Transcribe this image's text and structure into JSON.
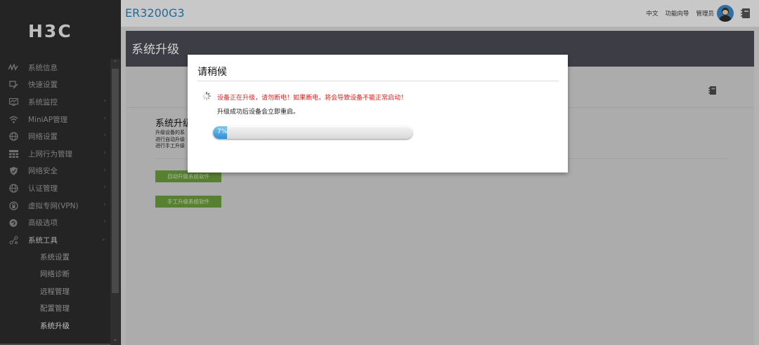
{
  "brand": {
    "logo": "H3C",
    "device_model": "ER3200G3"
  },
  "topbar": {
    "lang_link": "中文",
    "wizard_link": "功能向导",
    "admin_link": "管理员"
  },
  "sidebar": {
    "items": [
      {
        "label": "系统信息",
        "icon": "activity-icon",
        "has_children": false
      },
      {
        "label": "快速设置",
        "icon": "quick-setup-icon",
        "has_children": false
      },
      {
        "label": "系统监控",
        "icon": "monitor-icon",
        "has_children": true
      },
      {
        "label": "MiniAP管理",
        "icon": "wifi-icon",
        "has_children": true
      },
      {
        "label": "网络设置",
        "icon": "globe-icon",
        "has_children": true
      },
      {
        "label": "上网行为管理",
        "icon": "behavior-icon",
        "has_children": true
      },
      {
        "label": "网络安全",
        "icon": "shield-icon",
        "has_children": true
      },
      {
        "label": "认证管理",
        "icon": "globe-icon",
        "has_children": true
      },
      {
        "label": "虚拟专网(VPN)",
        "icon": "vpn-icon",
        "has_children": true
      },
      {
        "label": "高级选项",
        "icon": "advanced-icon",
        "has_children": true
      },
      {
        "label": "系统工具",
        "icon": "tools-icon",
        "has_children": true,
        "expanded": true
      }
    ],
    "subitems": [
      {
        "label": "系统设置",
        "active": false
      },
      {
        "label": "网络诊断",
        "active": false
      },
      {
        "label": "远程管理",
        "active": false
      },
      {
        "label": "配置管理",
        "active": false
      },
      {
        "label": "系统升级",
        "active": true
      }
    ]
  },
  "page": {
    "title": "系统升级",
    "section_title": "系统升级",
    "desc_lines": [
      "升级设备的系",
      "进行自动升级",
      "进行手工升级"
    ],
    "auto_upgrade_button": "自动升级系统软件",
    "manual_upgrade_button": "手工升级系统软件"
  },
  "dialog": {
    "title": "请稍候",
    "warning": "设备正在升级，请勿断电！如果断电，将会导致设备不能正常启动！",
    "info": "升级成功后设备会立即重启。",
    "progress_percent": 7,
    "progress_label": "7%"
  },
  "colors": {
    "accent": "#2a83b7",
    "sidebar_bg": "#2c2c2c",
    "header_bg": "#4a4b55",
    "button_green": "#6c9d3c",
    "warning_red": "#e02020",
    "progress_blue": "#2f8fd3"
  }
}
